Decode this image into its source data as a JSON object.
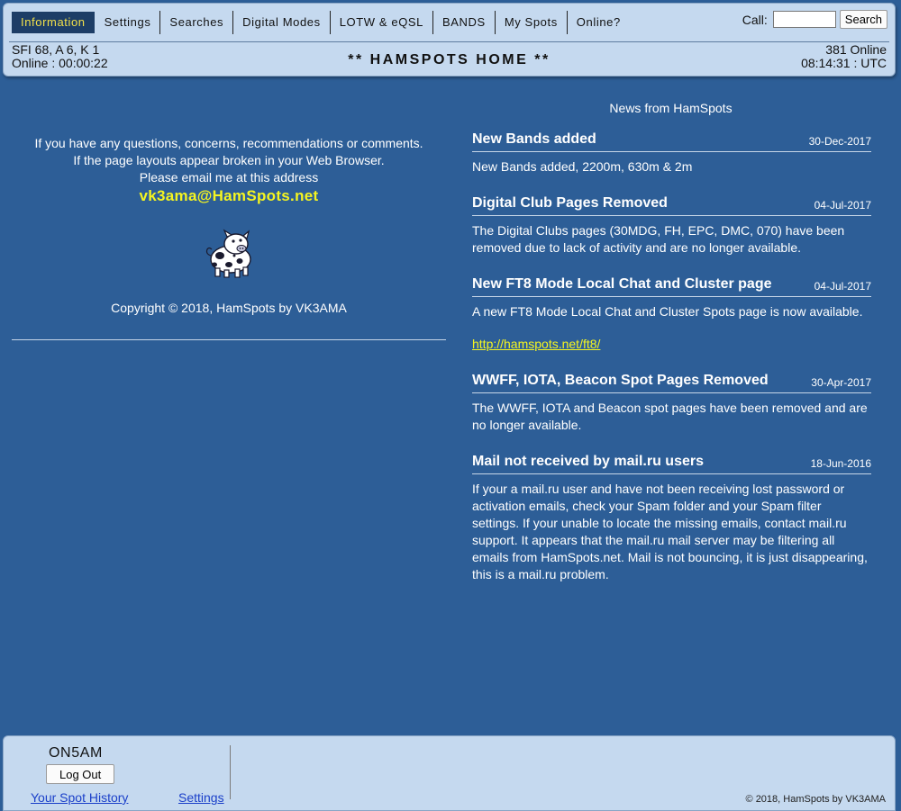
{
  "nav": {
    "items": [
      {
        "label": "Information",
        "active": true
      },
      {
        "label": "Settings"
      },
      {
        "label": "Searches"
      },
      {
        "label": "Digital Modes"
      },
      {
        "label": "LOTW & eQSL"
      },
      {
        "label": "BANDS"
      },
      {
        "label": "My Spots"
      },
      {
        "label": "Online?"
      }
    ],
    "call_label": "Call:",
    "call_value": "",
    "search_label": "Search"
  },
  "status": {
    "solar": "SFI 68, A 6, K 1",
    "online_time": "Online : 00:00:22",
    "online_count": "381 Online",
    "utc_time": "08:14:31 : UTC"
  },
  "page_title": "** HAMSPOTS HOME **",
  "contact": {
    "line1": "If you have any questions, concerns, recommendations or comments.",
    "line2": "If the page layouts appear broken in your Web Browser.",
    "line3": "Please email me at this address",
    "email": "vk3ama@HamSpots.net",
    "copyright": "Copyright © 2018, HamSpots by VK3AMA"
  },
  "news": {
    "header": "News from HamSpots",
    "items": [
      {
        "title": "New Bands added",
        "date": "30-Dec-2017",
        "body": "New Bands added, 2200m, 630m & 2m"
      },
      {
        "title": "Digital Club Pages Removed",
        "date": "04-Jul-2017",
        "body": "The Digital Clubs pages (30MDG, FH, EPC, DMC, 070) have been removed due to lack of activity and are no longer available."
      },
      {
        "title": "New FT8 Mode Local Chat and Cluster page",
        "date": "04-Jul-2017",
        "body": "A new FT8 Mode Local Chat and Cluster Spots page is now available.",
        "link": "http://hamspots.net/ft8/"
      },
      {
        "title": "WWFF, IOTA, Beacon Spot Pages Removed",
        "date": "30-Apr-2017",
        "body": "The WWFF, IOTA and Beacon spot pages have been removed and are no longer available."
      },
      {
        "title": "Mail not received by mail.ru users",
        "date": "18-Jun-2016",
        "body": "If your a mail.ru user and have not been receiving lost password or activation emails, check your Spam folder and your Spam filter settings. If your unable to locate the missing emails, contact mail.ru support. It appears that the mail.ru mail server may be filtering all emails from HamSpots.net. Mail is not bouncing, it is just disappearing, this is a mail.ru problem."
      }
    ]
  },
  "footer": {
    "callsign": "ON5AM",
    "logout_label": "Log Out",
    "spot_history_label": "Your Spot History",
    "settings_label": "Settings",
    "copyright": "© 2018, HamSpots by VK3AMA"
  },
  "colors": {
    "page_bg": "#2d5e97",
    "bar_bg": "#c5d9ef",
    "active_tab_bg": "#1d3d66",
    "highlight_yellow": "#f5f520",
    "link_blue": "#1a3fc9"
  },
  "icons": {
    "mascot": "cow-pig-mascot-icon"
  }
}
